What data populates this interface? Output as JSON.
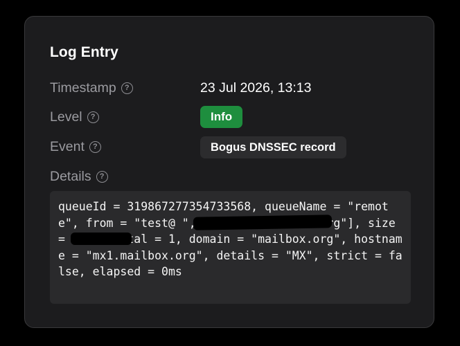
{
  "card": {
    "title": "Log Entry"
  },
  "fields": {
    "timestamp": {
      "label": "Timestamp",
      "value": "23 Jul 2026, 13:13"
    },
    "level": {
      "label": "Level",
      "value": "Info",
      "color": "#1e8e3e"
    },
    "event": {
      "label": "Event",
      "value": "Bogus DNSSEC record"
    },
    "details": {
      "label": "Details",
      "value": "queueId = 319867277354733568, queueName = \"remote\", from = \"test@                    \", to = [\"          @mailbox.org\"], size = 1350, total = 1, domain = \"mailbox.org\", hostname = \"mx1.mailbox.org\", details = \"MX\", strict = false, elapsed = 0ms"
    }
  },
  "icons": {
    "help": "question-circle-icon",
    "help_glyph": "?"
  },
  "colors": {
    "background": "#000000",
    "card": "#1c1c1e",
    "label": "#9b9ba0",
    "code_background": "#2a2a2c"
  }
}
